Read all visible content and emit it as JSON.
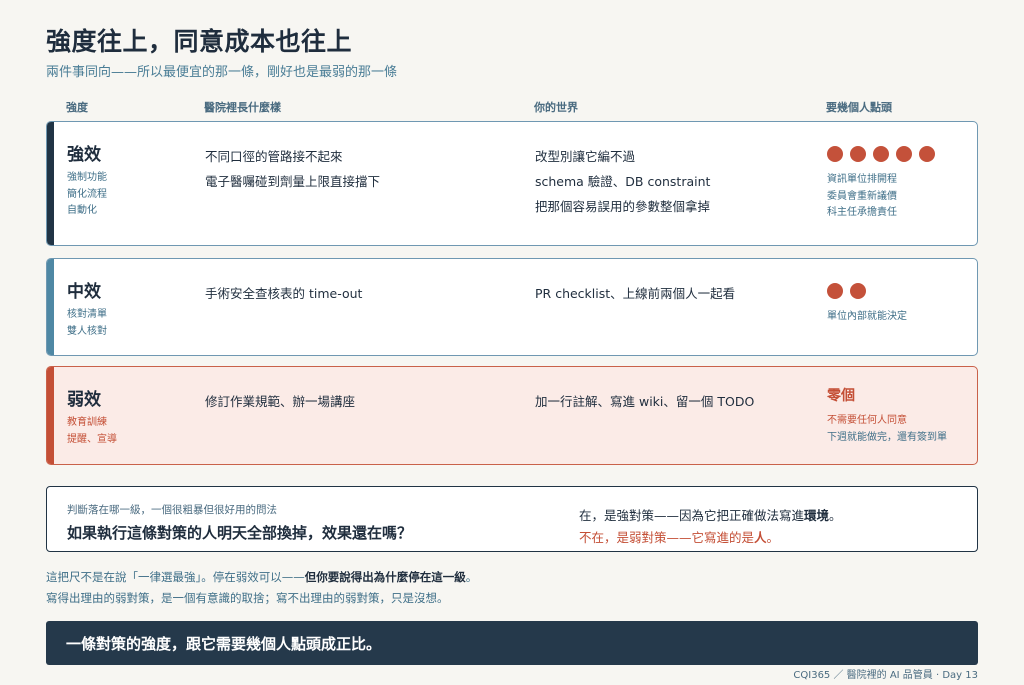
{
  "header": {
    "title": "強度往上，同意成本也往上",
    "subtitle": "兩件事同向——所以最便宜的那一條，剛好也是最弱的那一條"
  },
  "columns": {
    "strength": "強度",
    "hospital": "醫院裡長什麼樣",
    "world": "你的世界",
    "people": "要幾個人點頭"
  },
  "rows": {
    "strong": {
      "level": "強效",
      "desc": [
        "強制功能",
        "簡化流程",
        "自動化"
      ],
      "hospital": [
        "不同口徑的管路接不起來",
        "電子醫囑碰到劑量上限直接擋下"
      ],
      "world": [
        "改型別讓它編不過",
        "schema 驗證、DB constraint",
        "把那個容易誤用的參數整個拿掉"
      ],
      "people_count": 5,
      "who": [
        "資訊單位排開程",
        "委員會重新議價",
        "科主任承擔責任"
      ]
    },
    "mid": {
      "level": "中效",
      "desc": [
        "核對清單",
        "雙人核對"
      ],
      "hospital": [
        "手術安全查核表的 time-out"
      ],
      "world": [
        "PR checklist、上線前兩個人一起看"
      ],
      "people_count": 2,
      "who": [
        "單位內部就能決定"
      ]
    },
    "weak": {
      "level": "弱效",
      "desc": [
        "教育訓練",
        "提醒、宣導"
      ],
      "hospital": [
        "修訂作業規範、辦一場講座"
      ],
      "world": [
        "加一行註解、寫進 wiki、留一個 TODO"
      ],
      "zero": "零個",
      "who": [
        "不需要任何人同意",
        "下週就能做完，還有簽到單"
      ]
    }
  },
  "test": {
    "hint": "判斷落在哪一級，一個很粗暴但很好用的問法",
    "question": "如果執行這條對策的人明天全部換掉，效果還在嗎？",
    "yes_prefix": "在，是強對策——因為它把正確做法寫進",
    "yes_bold": "環境",
    "yes_suffix": "。",
    "no_prefix": "不在，是弱對策——它寫進的是",
    "no_bold": "人",
    "no_suffix": "。"
  },
  "notes": {
    "line1_prefix": "這把尺不是在說「一律選最強」。停在弱效可以——",
    "line1_bold": "但你要說得出為什麼停在這一級",
    "line1_suffix": "。",
    "line2": "寫得出理由的弱對策，是一個有意識的取捨；寫不出理由的弱對策，只是沒想。"
  },
  "banner": "一條對策的強度，跟它需要幾個人點頭成正比。",
  "footer": "CQI365 ／ 醫院裡的 AI 品管員 · Day 13",
  "colors": {
    "navy": "#213445",
    "teal": "#4f88a4",
    "red": "#c44f36",
    "weak_bg": "#fbebe7"
  }
}
